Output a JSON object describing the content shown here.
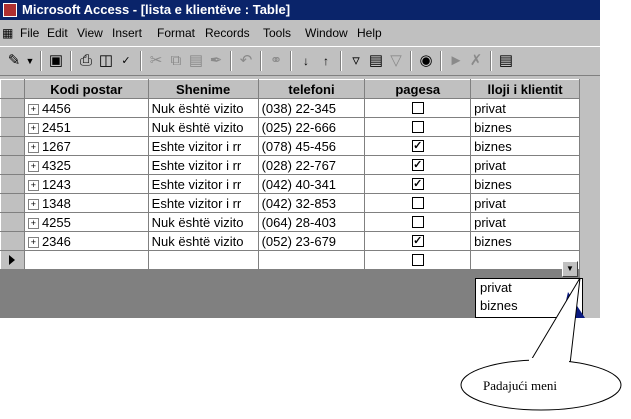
{
  "window": {
    "title": "Microsoft Access - [lista e klientëve : Table]"
  },
  "menu": [
    "File",
    "Edit",
    "View",
    "Insert",
    "Format",
    "Records",
    "Tools",
    "Window",
    "Help"
  ],
  "toolbar_icons": [
    "view-icon",
    "dropdown-arrow-icon",
    "save-icon",
    "print-icon",
    "print-preview-icon",
    "spelling-icon",
    "cut-icon",
    "copy-icon",
    "paste-icon",
    "format-painter-icon",
    "undo-icon",
    "hyperlink-icon",
    "sort-ascending-icon",
    "sort-descending-icon",
    "filter-by-selection-icon",
    "filter-by-form-icon",
    "apply-filter-icon",
    "find-icon",
    "new-record-icon",
    "delete-record-icon",
    "properties-icon"
  ],
  "table": {
    "columns": [
      "Kodi postar",
      "Shenime",
      "telefoni",
      "pagesa",
      "lloji i klientit"
    ],
    "rows": [
      {
        "kodi": "4456",
        "shenime": "Nuk është vizito",
        "telefoni": "(038) 22-345",
        "pagesa": false,
        "lloji": "privat"
      },
      {
        "kodi": "2451",
        "shenime": "Nuk është vizito",
        "telefoni": "(025) 22-666",
        "pagesa": false,
        "lloji": "biznes"
      },
      {
        "kodi": "1267",
        "shenime": "Eshte vizitor i rr",
        "telefoni": "(078) 45-456",
        "pagesa": true,
        "lloji": "biznes"
      },
      {
        "kodi": "4325",
        "shenime": "Eshte vizitor i rr",
        "telefoni": "(028) 22-767",
        "pagesa": true,
        "lloji": "privat"
      },
      {
        "kodi": "1243",
        "shenime": "Eshte vizitor i rr",
        "telefoni": "(042) 40-341",
        "pagesa": true,
        "lloji": "biznes"
      },
      {
        "kodi": "1348",
        "shenime": "Eshte vizitor i rr",
        "telefoni": "(042) 32-853",
        "pagesa": false,
        "lloji": "privat"
      },
      {
        "kodi": "4255",
        "shenime": "Nuk është vizito",
        "telefoni": "(064) 28-403",
        "pagesa": false,
        "lloji": "privat"
      },
      {
        "kodi": "2346",
        "shenime": "Nuk është vizito",
        "telefoni": "(052) 23-679",
        "pagesa": true,
        "lloji": "biznes"
      }
    ]
  },
  "dropdown": {
    "options": [
      "privat",
      "biznes"
    ]
  },
  "callout": {
    "text": "Padajući meni"
  },
  "colors": {
    "title_bar": "#0a246a",
    "chrome": "#c0c0c0",
    "callout_pointer": "#0a1a80"
  }
}
